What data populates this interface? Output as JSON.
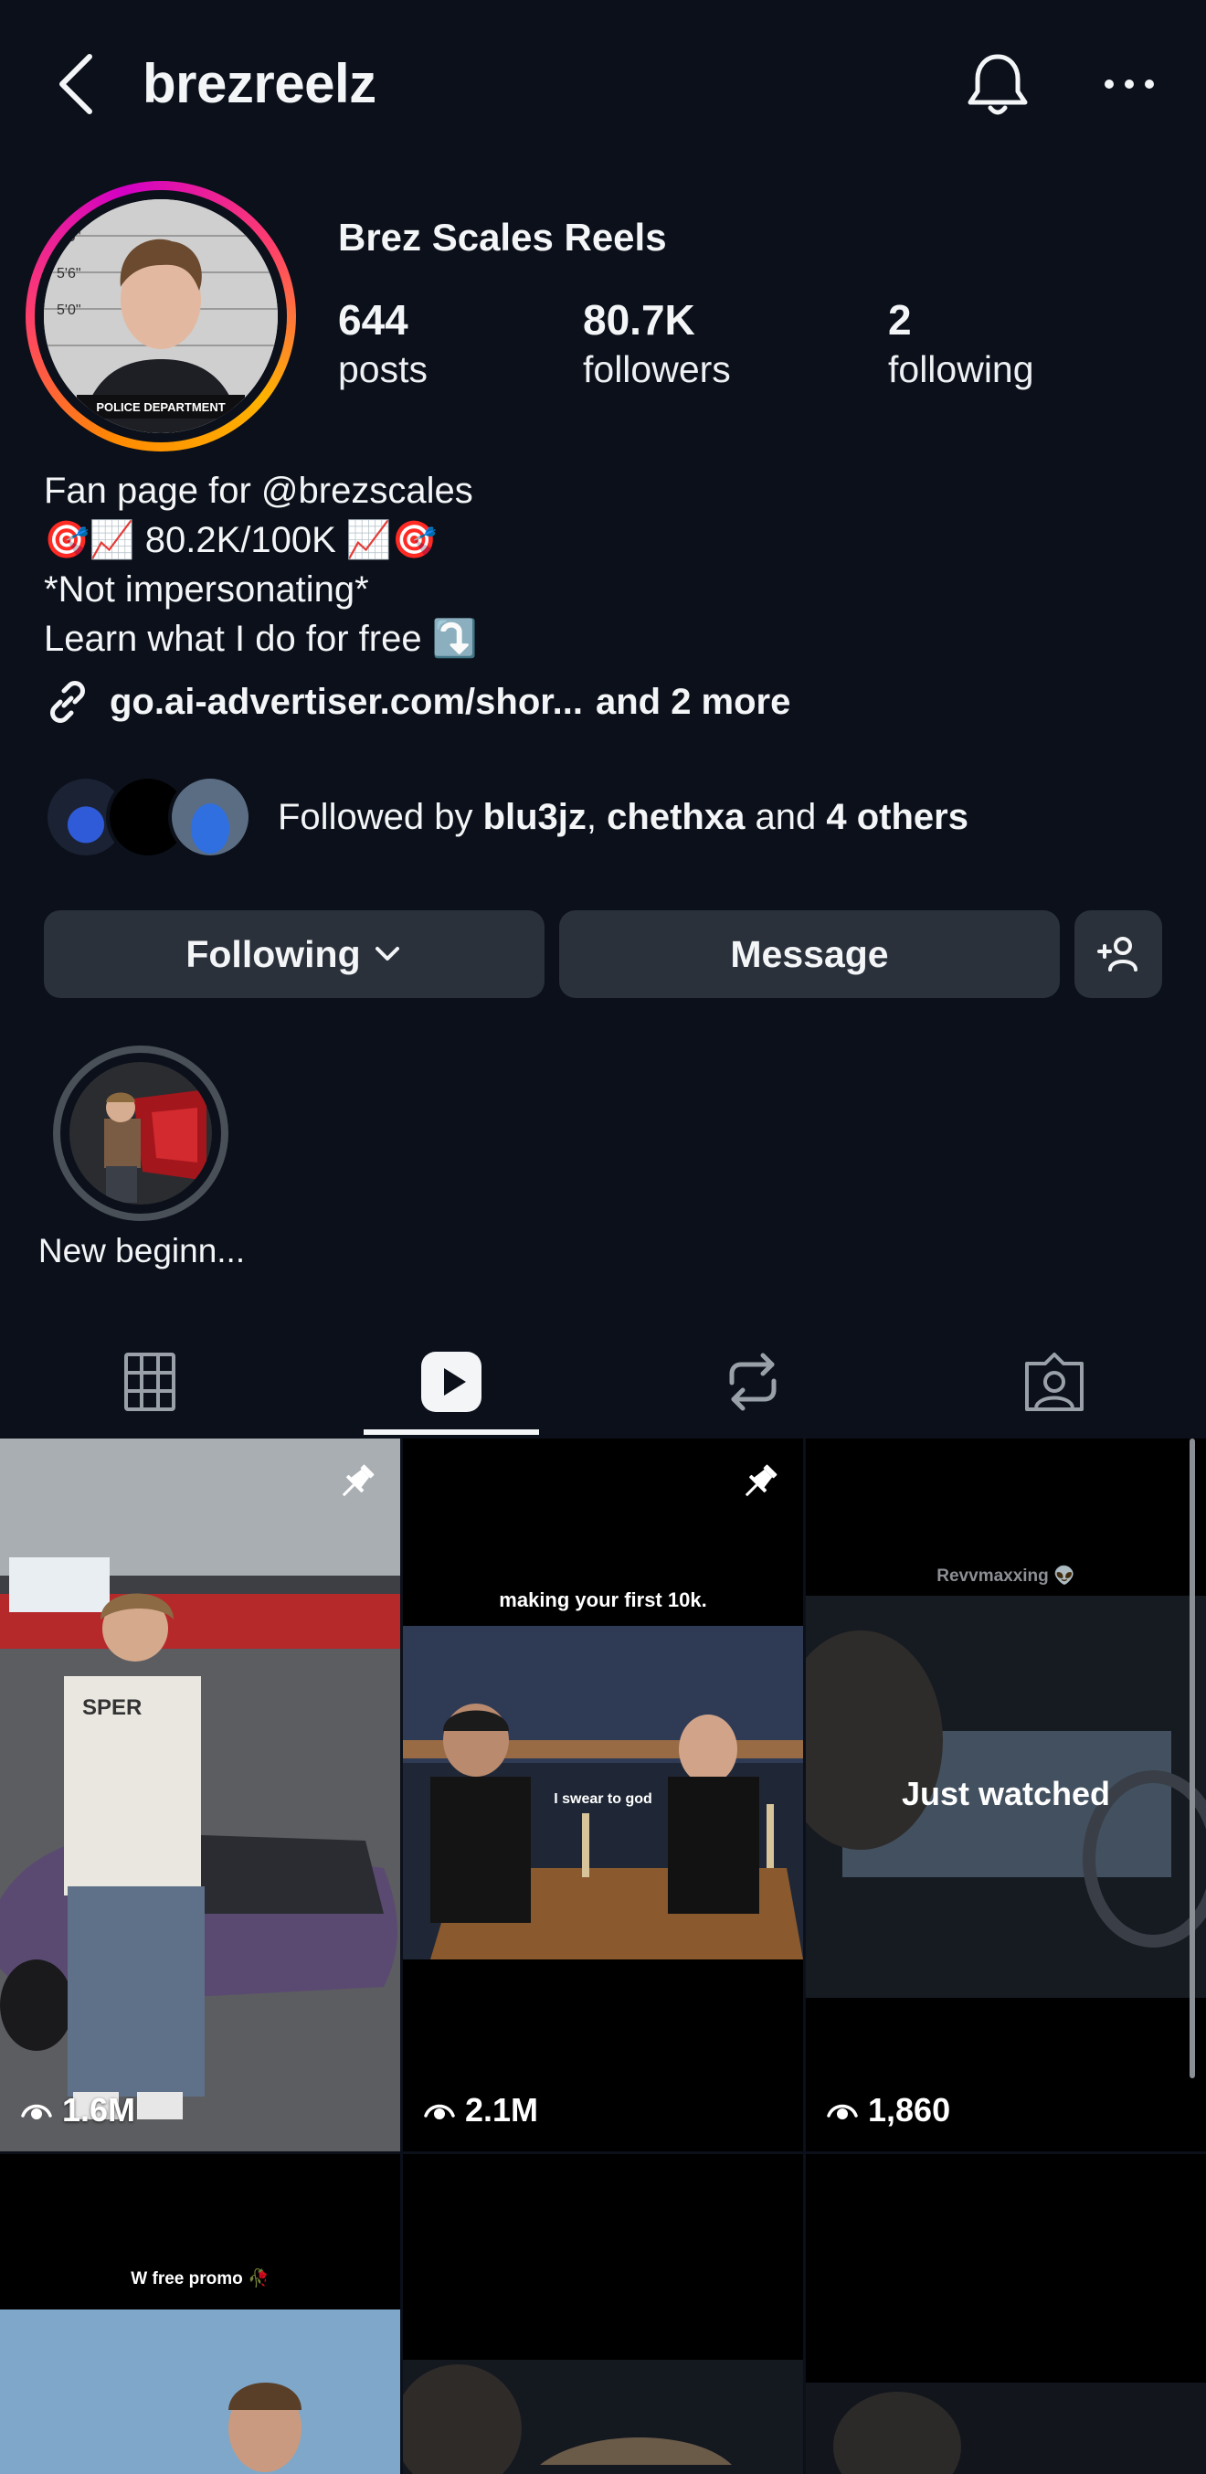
{
  "header": {
    "username": "brezreelz",
    "icons": [
      "back-arrow-icon",
      "bell-icon",
      "more-horizontal-icon"
    ]
  },
  "profile": {
    "display_name": "Brez Scales Reels",
    "avatar_caption": "POLICE DEPARTMENT",
    "avatar_heights": [
      "5'9\"",
      "5'6\"",
      "5'0\""
    ],
    "stats": [
      {
        "value": "644",
        "label": "posts"
      },
      {
        "value": "80.7K",
        "label": "followers"
      },
      {
        "value": "2",
        "label": "following"
      }
    ],
    "bio_lines": [
      "Fan page for @brezscales",
      "🎯📈 80.2K/100K 📈🎯",
      "*Not impersonating*",
      "Learn what I do for free ⤵️"
    ],
    "link_text": "go.ai-advertiser.com/shor...",
    "link_more": "and 2 more",
    "followed_by": {
      "prefix": "Followed by",
      "user1": "blu3jz",
      "sep": ",",
      "user2": "chethxa",
      "and": "and",
      "others": "4 others"
    }
  },
  "actions": {
    "following_label": "Following",
    "message_label": "Message"
  },
  "highlights": [
    {
      "label": "New beginn..."
    }
  ],
  "tabs": [
    "grid-icon",
    "reels-icon",
    "reposts-icon",
    "tagged-icon"
  ],
  "active_tab": 1,
  "grid": [
    {
      "views": "1.6M",
      "pinned": true
    },
    {
      "views": "2.1M",
      "pinned": true,
      "caption_top": "making your first 10k.",
      "caption_mid": "I swear to god"
    },
    {
      "views": "1,860",
      "pinned": false,
      "watermark": "Revvmaxxing 👽",
      "overlay": "Just watched"
    },
    {
      "caption_top": "W free promo 🥀"
    },
    {},
    {}
  ],
  "colors": {
    "background": "#0b101a",
    "button": "#2a313b",
    "text": "#f3f5f7",
    "ring_start": "#ff8a00",
    "ring_end": "#d300c5"
  }
}
